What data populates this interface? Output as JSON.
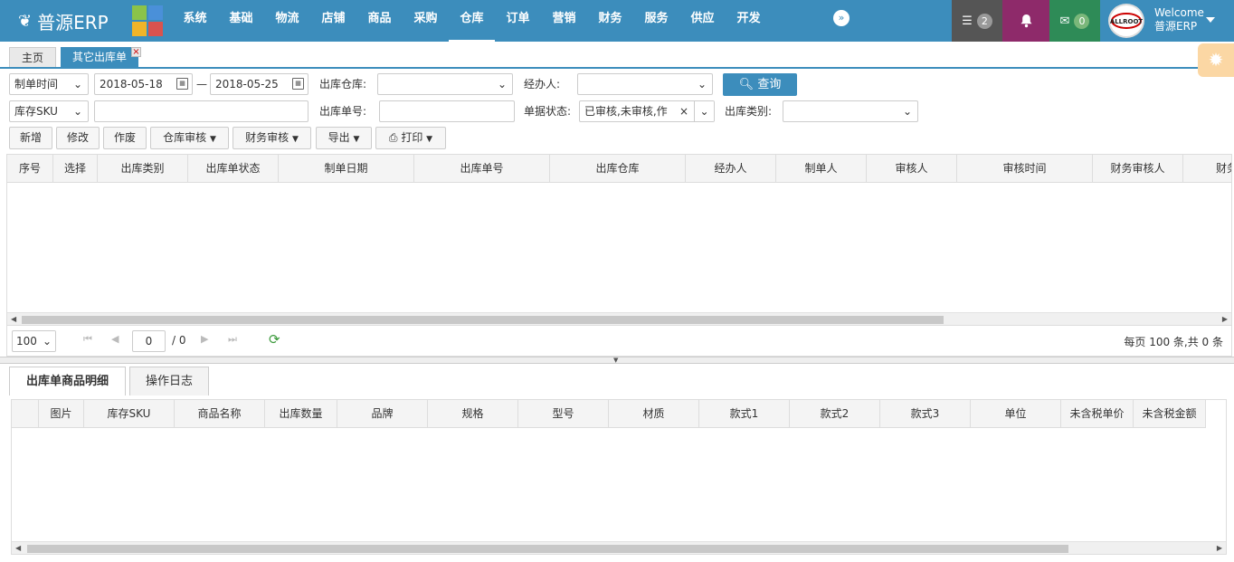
{
  "app": {
    "title": "普源ERP"
  },
  "nav": {
    "items": [
      "系统",
      "基础",
      "物流",
      "店铺",
      "商品",
      "采购",
      "仓库",
      "订单",
      "营销",
      "财务",
      "服务",
      "供应",
      "开发"
    ],
    "active_index": 6
  },
  "toolbar": {
    "tasks_count": "2",
    "messages_count": "0"
  },
  "user": {
    "welcome": "Welcome",
    "name": "普源ERP",
    "avatar_text": "ALLROOT"
  },
  "page_tabs": {
    "home": "主页",
    "current": "其它出库单"
  },
  "filters": {
    "date_type": "制单时间",
    "date_from": "2018-05-18",
    "date_sep": "—",
    "date_to": "2018-05-25",
    "warehouse_label": "出库仓库:",
    "handler_label": "经办人:",
    "sku_type": "库存SKU",
    "outbound_no_label": "出库单号:",
    "status_label": "单据状态:",
    "status_value": "已审核,未审核,作",
    "category_label": "出库类别:"
  },
  "query_button": "查询",
  "actions": {
    "add": "新增",
    "edit": "修改",
    "void": "作废",
    "warehouse_audit": "仓库审核",
    "finance_audit": "财务审核",
    "export": "导出",
    "print": "打印"
  },
  "main_grid": {
    "columns": [
      "序号",
      "选择",
      "出库类别",
      "出库单状态",
      "制单日期",
      "出库单号",
      "出库仓库",
      "经办人",
      "制单人",
      "审核人",
      "审核时间",
      "财务审核人",
      "财务"
    ]
  },
  "pager": {
    "page_size": "100",
    "current_page": "0",
    "total_pages": "/ 0",
    "summary": "每页 100 条,共 0 条"
  },
  "detail_tabs": {
    "items": "出库单商品明细",
    "log": "操作日志"
  },
  "detail_grid": {
    "columns": [
      "",
      "图片",
      "库存SKU",
      "商品名称",
      "出库数量",
      "品牌",
      "规格",
      "型号",
      "材质",
      "款式1",
      "款式2",
      "款式3",
      "单位",
      "未含税单价",
      "未含税金额"
    ]
  },
  "colors": {
    "primary": "#3c8dbc",
    "tasks": "#555555",
    "alerts": "#8e2a6a",
    "messages": "#2e8b57",
    "gear": "#fbd7a4"
  },
  "icons": {
    "logo": "leaf-icon",
    "more": "double-chevron-icon",
    "tasks": "list-icon",
    "alerts": "bell-icon",
    "messages": "envelope-icon",
    "settings": "gear-icon",
    "search": "search-icon",
    "print": "printer-icon",
    "refresh": "refresh-icon"
  }
}
